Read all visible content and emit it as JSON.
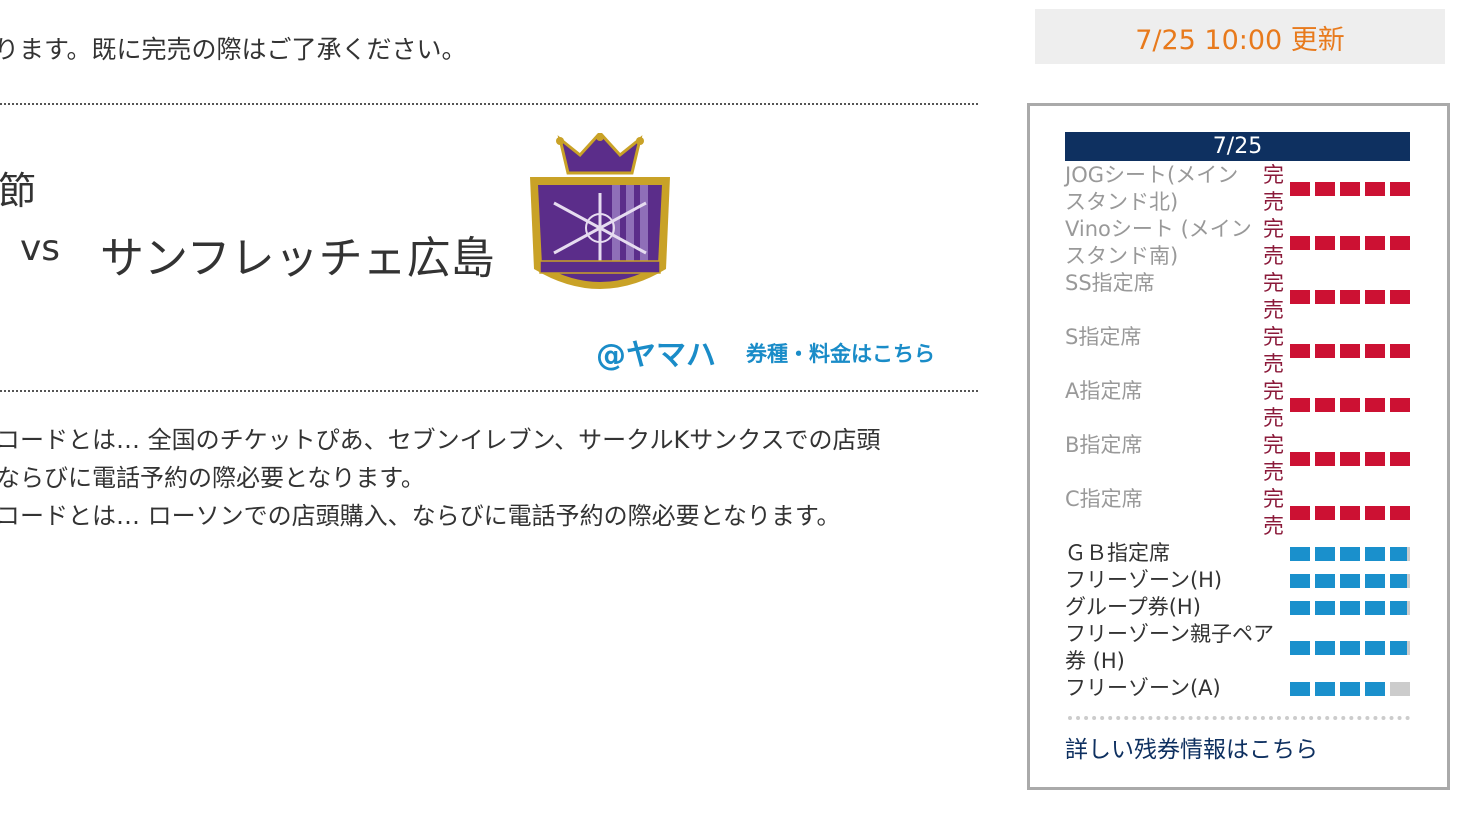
{
  "notice": "ります。既に完売の際はご了承ください。",
  "match": {
    "round": "節",
    "vs": "vs",
    "opponent": "サンフレッチェ広島",
    "emblem_icon": "sanfrecce-hiroshima-emblem",
    "emblem_colors": {
      "purple": "#5b2d8a",
      "gold": "#c9a227"
    },
    "venue": "@ヤマハ",
    "price_link": "券種・料金はこちら"
  },
  "info_lines": [
    "コードとは… 全国のチケットぴあ、セブンイレブン、サークルKサンクスでの店頭",
    "ならびに電話予約の際必要となります。",
    "コードとは… ローソンでの店頭購入、ならびに電話予約の際必要となります。"
  ],
  "update_text": "7/25 10:00 更新",
  "availability": {
    "date": "7/25",
    "colors": {
      "sold_out": "#cc1133",
      "available": "#1a90cc",
      "empty": "#cccccc",
      "header": "#0e3060",
      "update": "#e87a1c"
    },
    "sold_out_seats": [
      {
        "name": "JOGシート(メインスタンド北)",
        "status": "完売"
      },
      {
        "name": "Vinoシート (メインスタンド南)",
        "status": "完売"
      },
      {
        "name": "SS指定席",
        "status": "完売"
      },
      {
        "name": "S指定席",
        "status": "完売"
      },
      {
        "name": "A指定席",
        "status": "完売"
      },
      {
        "name": "B指定席",
        "status": "完売"
      },
      {
        "name": "C指定席",
        "status": "完売"
      }
    ],
    "available_seats": [
      {
        "name": "ＧＢ指定席",
        "level": 0.97
      },
      {
        "name": "フリーゾーン(H)",
        "level": 0.97
      },
      {
        "name": "グループ券(H)",
        "level": 0.97
      },
      {
        "name": "フリーゾーン親子ペア券 (H)",
        "level": 0.97
      },
      {
        "name": "フリーゾーン(A)",
        "level": 0.8
      }
    ],
    "detail_link": "詳しい残券情報はこちら"
  }
}
